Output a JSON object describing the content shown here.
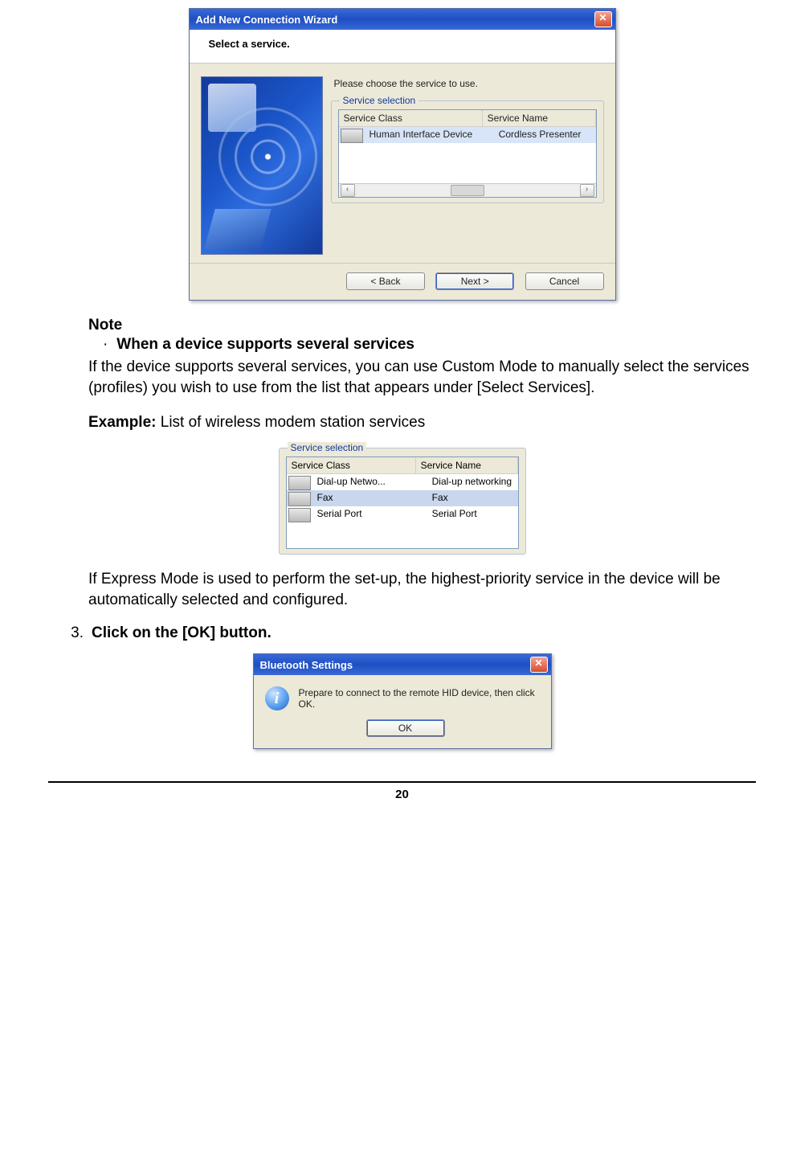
{
  "wizard": {
    "title": "Add New Connection Wizard",
    "subtitle": "Select a service.",
    "instruction": "Please choose the service to use.",
    "group_label": "Service selection",
    "columns": {
      "class": "Service Class",
      "name": "Service Name"
    },
    "rows": [
      {
        "class": "Human Interface Device",
        "name": "Cordless Presenter",
        "selected": true
      }
    ],
    "buttons": {
      "back": "< Back",
      "next": "Next >",
      "cancel": "Cancel"
    }
  },
  "note": {
    "heading": "Note",
    "bullet_title": "When a device supports several services",
    "para1": "If the device supports several services, you can use Custom Mode to manually select the services (profiles) you wish to use from the list that appears under [Select Services].",
    "example_label": "Example:",
    "example_text": " List of wireless modem station services"
  },
  "small_list": {
    "group_label": "Service selection",
    "columns": {
      "class": "Service Class",
      "name": "Service Name"
    },
    "rows": [
      {
        "class": "Dial-up Netwo...",
        "name": "Dial-up networking",
        "selected": false
      },
      {
        "class": "Fax",
        "name": "Fax",
        "selected": true
      },
      {
        "class": "Serial Port",
        "name": "Serial Port",
        "selected": false
      }
    ]
  },
  "para_after_list": "If Express Mode is used to perform the set-up, the highest-priority service in the device will be automatically selected and configured.",
  "step3": {
    "num": "3.",
    "text": "Click on the [OK] button."
  },
  "info_dialog": {
    "title": "Bluetooth Settings",
    "message": "Prepare to connect to the remote HID device, then click OK.",
    "ok": "OK"
  },
  "page_number": "20"
}
